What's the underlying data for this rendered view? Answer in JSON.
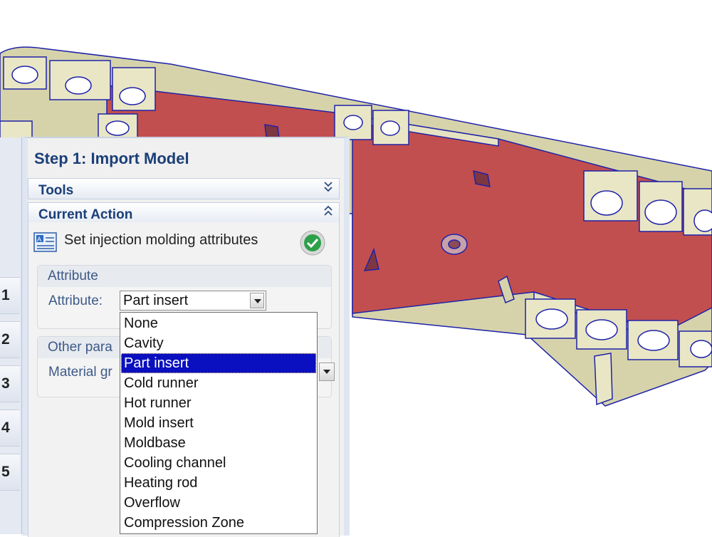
{
  "panel": {
    "title": "Step 1: Import Model",
    "steps": [
      "1",
      "2",
      "3",
      "4",
      "5"
    ],
    "tools_label": "Tools",
    "current_action_label": "Current Action",
    "action_text": "Set injection molding attributes",
    "attribute_group": {
      "title": "Attribute",
      "field_label": "Attribute:",
      "selected_value": "Part insert"
    },
    "other_group": {
      "title_visible": "Other para",
      "field_label_visible": "Material gr"
    }
  },
  "dropdown": {
    "options": [
      "None",
      "Cavity",
      "Part insert",
      "Cold runner",
      "Hot runner",
      "Mold insert",
      "Moldbase",
      "Cooling channel",
      "Heating rod",
      "Overflow",
      "Compression Zone"
    ],
    "selected_index": 2
  },
  "colors": {
    "accent": "#1a3f78",
    "selection": "#0a0fbf",
    "model_frame": "#d6d3ab",
    "model_cavity": "#c24f4f",
    "model_edge": "#1e22a8"
  },
  "icons": [
    "attribute-icon",
    "check-icon",
    "chevron-down-double-icon",
    "chevron-up-double-icon",
    "dropdown-arrow-icon"
  ]
}
